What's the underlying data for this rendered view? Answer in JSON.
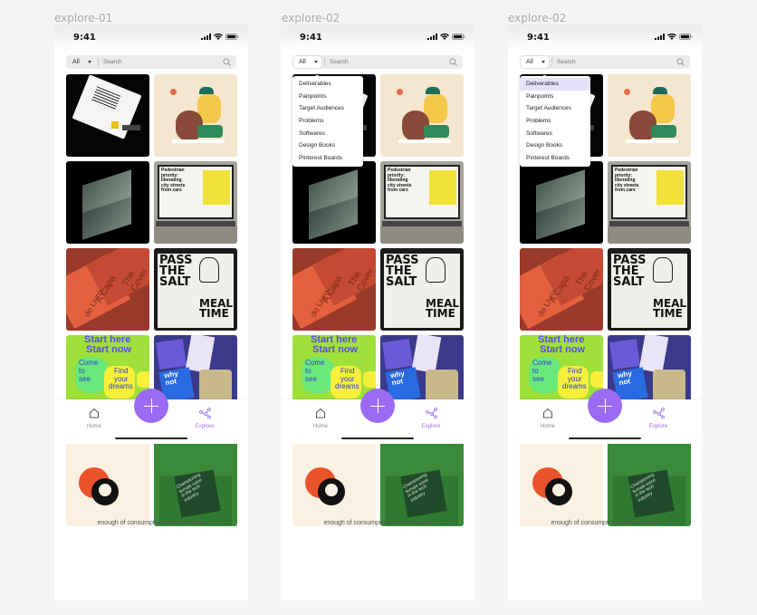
{
  "frames": [
    {
      "label": "explore-01",
      "dropdown_open": false,
      "selected_index": -1
    },
    {
      "label": "explore-02",
      "dropdown_open": true,
      "selected_index": -1
    },
    {
      "label": "explore-02",
      "dropdown_open": true,
      "selected_index": 0
    }
  ],
  "status": {
    "time": "9:41"
  },
  "search": {
    "filter": "All",
    "placeholder": "Search"
  },
  "dropdown_options": [
    "Deliverables",
    "Painpoints",
    "Target Audiences",
    "Problems",
    "Softwares",
    "Design Books",
    "Pinterest Boards"
  ],
  "tiles": {
    "pedestrian_text": [
      "Pedestrian",
      "priority:",
      "liberating",
      "city streets",
      "from cars"
    ],
    "capa_text": [
      "A Capa",
      "do Livro",
      "The Cover"
    ],
    "salt_text": [
      "PASS",
      "THE",
      "SALT"
    ],
    "meal_text": [
      "MEAL",
      "TIME"
    ],
    "start_text": [
      "Start here",
      "Start now"
    ],
    "come_text": [
      "Come",
      "to",
      "see"
    ],
    "find_text": [
      "Find",
      "your",
      "dreams"
    ],
    "why_text": [
      "why",
      "not"
    ],
    "green_book_text": [
      "Championing",
      "female voice",
      "in the tech",
      "industry"
    ]
  },
  "nav": {
    "home": "Home",
    "explore": "Explore"
  },
  "tagline": "enough of consumption, time to create",
  "colors": {
    "accent": "#9b6cf3",
    "selected_option_bg": "#e7e0fb"
  },
  "icons": [
    "signal-icon",
    "wifi-icon",
    "battery-icon",
    "search-icon",
    "home-icon",
    "explore-icon",
    "plus-icon"
  ]
}
